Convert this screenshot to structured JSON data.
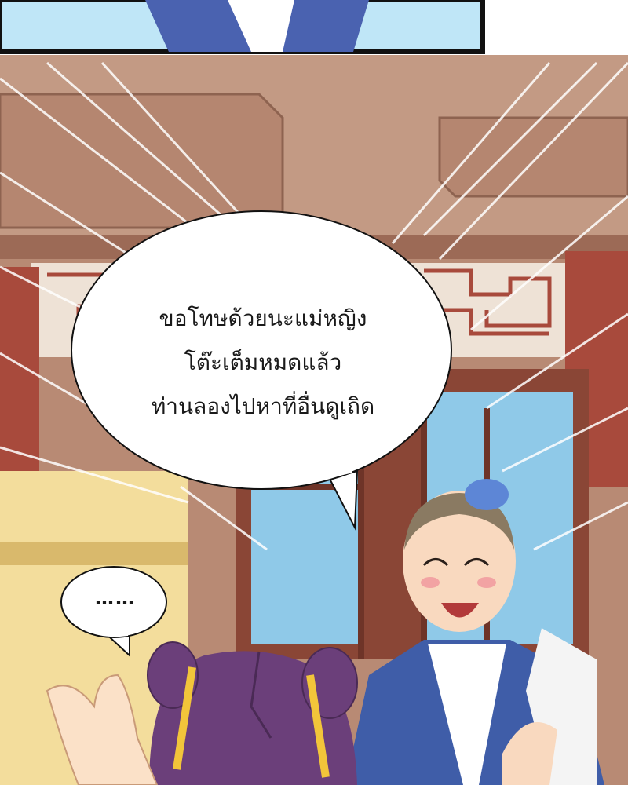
{
  "speech_bubble": {
    "lines": [
      "ขอโทษด้วยนะแม่หญิง",
      "โต๊ะเต็มหมดแล้ว",
      "ท่านลองไปหาที่อื่นดูเถิด"
    ]
  },
  "small_bubble": {
    "text": "……"
  },
  "colors": {
    "wall": "#b88a74",
    "lattice_red": "#a84a3c",
    "sky": "#8fc9e8",
    "robe_blue": "#3f5da8",
    "hair_purple": "#6b3f7a",
    "ribbon_yellow": "#f2c53a"
  }
}
